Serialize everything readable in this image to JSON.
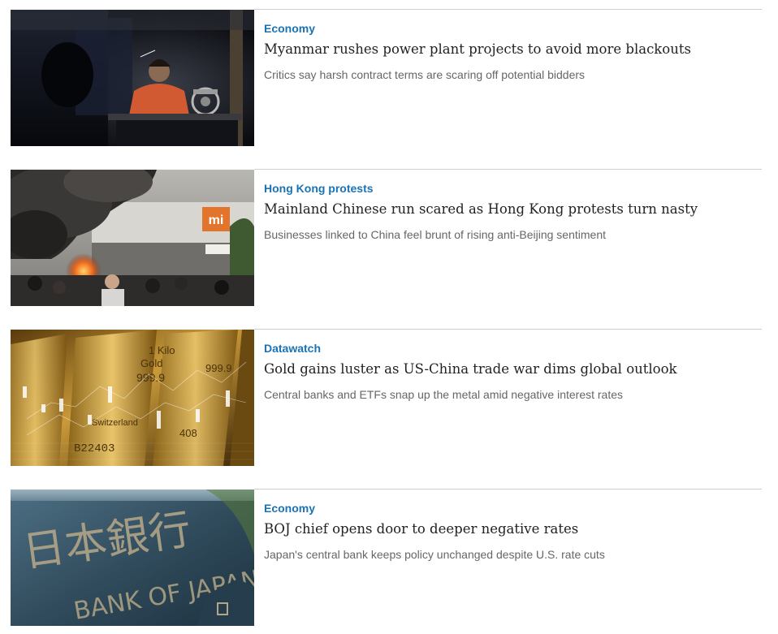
{
  "articles": [
    {
      "category": "Economy",
      "headline": "Myanmar rushes power plant projects to avoid more blackouts",
      "summary": "Critics say harsh contract terms are scaring off potential bidders",
      "image": "woman-sewing-in-dark-workshop-photo"
    },
    {
      "category": "Hong Kong protests",
      "headline": "Mainland Chinese run scared as Hong Kong protests turn nasty",
      "summary": "Businesses linked to China feel brunt of rising anti-Beijing sentiment",
      "image": "burning-storefront-protest-photo",
      "sign_text": "mi"
    },
    {
      "category": "Datawatch",
      "headline": "Gold gains luster as US-China trade war dims global outlook",
      "summary": "Central banks and ETFs snap up the metal amid negative interest rates",
      "image": "gold-bars-with-candlestick-chart-photo",
      "bar_text": [
        "1 Kilo",
        "Gold",
        "999.9",
        "Switzerland",
        "B22403",
        "408"
      ]
    },
    {
      "category": "Economy",
      "headline": "BOJ chief opens door to deeper negative rates",
      "summary": "Japan's central bank keeps policy unchanged despite U.S. rate cuts",
      "image": "bank-of-japan-sign-photo",
      "sign_text": [
        "日本銀行",
        "BANK OF JAPAN"
      ]
    }
  ],
  "colors": {
    "category": "#1a73b5",
    "headline": "#222222",
    "summary": "#666666",
    "divider": "#cfcfcf"
  }
}
